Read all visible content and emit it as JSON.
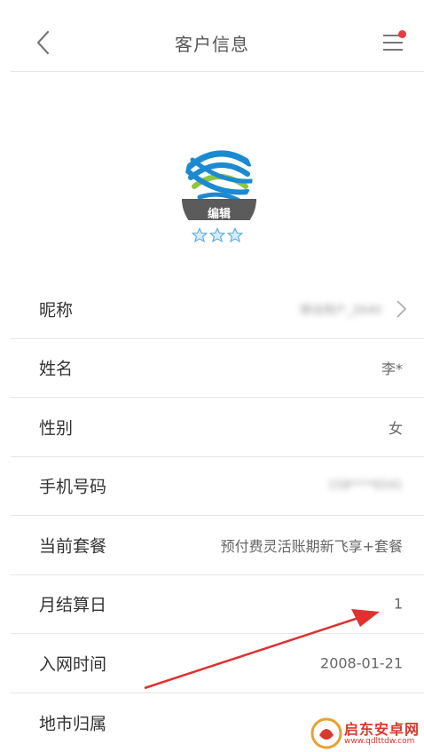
{
  "header": {
    "title": "客户信息",
    "back_icon": "chevron-left-icon",
    "menu_icon": "menu-icon",
    "notification_dot_color": "#ea3c3c"
  },
  "profile": {
    "avatar_icon": "china-mobile-logo",
    "edit_label": "编辑",
    "star_rating": 3,
    "star_icon": "star-icon"
  },
  "rows": [
    {
      "label": "昵称",
      "value": "移动用户_2640",
      "blurred": true,
      "has_arrow": true
    },
    {
      "label": "姓名",
      "value": "李*",
      "blurred": false,
      "has_arrow": false
    },
    {
      "label": "性别",
      "value": "女",
      "blurred": false,
      "has_arrow": false
    },
    {
      "label": "手机号码",
      "value": "158****6541",
      "blurred": true,
      "has_arrow": false
    },
    {
      "label": "当前套餐",
      "value": "预付费灵活账期新飞享+套餐",
      "blurred": false,
      "has_arrow": false
    },
    {
      "label": "月结算日",
      "value": "1",
      "blurred": false,
      "has_arrow": false
    },
    {
      "label": "入网时间",
      "value": "2008-01-21",
      "blurred": false,
      "has_arrow": false
    },
    {
      "label": "地市归属",
      "value": "",
      "blurred": false,
      "has_arrow": false
    }
  ],
  "annotation": {
    "arrow_color": "#e03030"
  },
  "watermark": {
    "title": "启东安卓网",
    "url": "www.qdlttdw.com",
    "color": "#d8392b"
  }
}
